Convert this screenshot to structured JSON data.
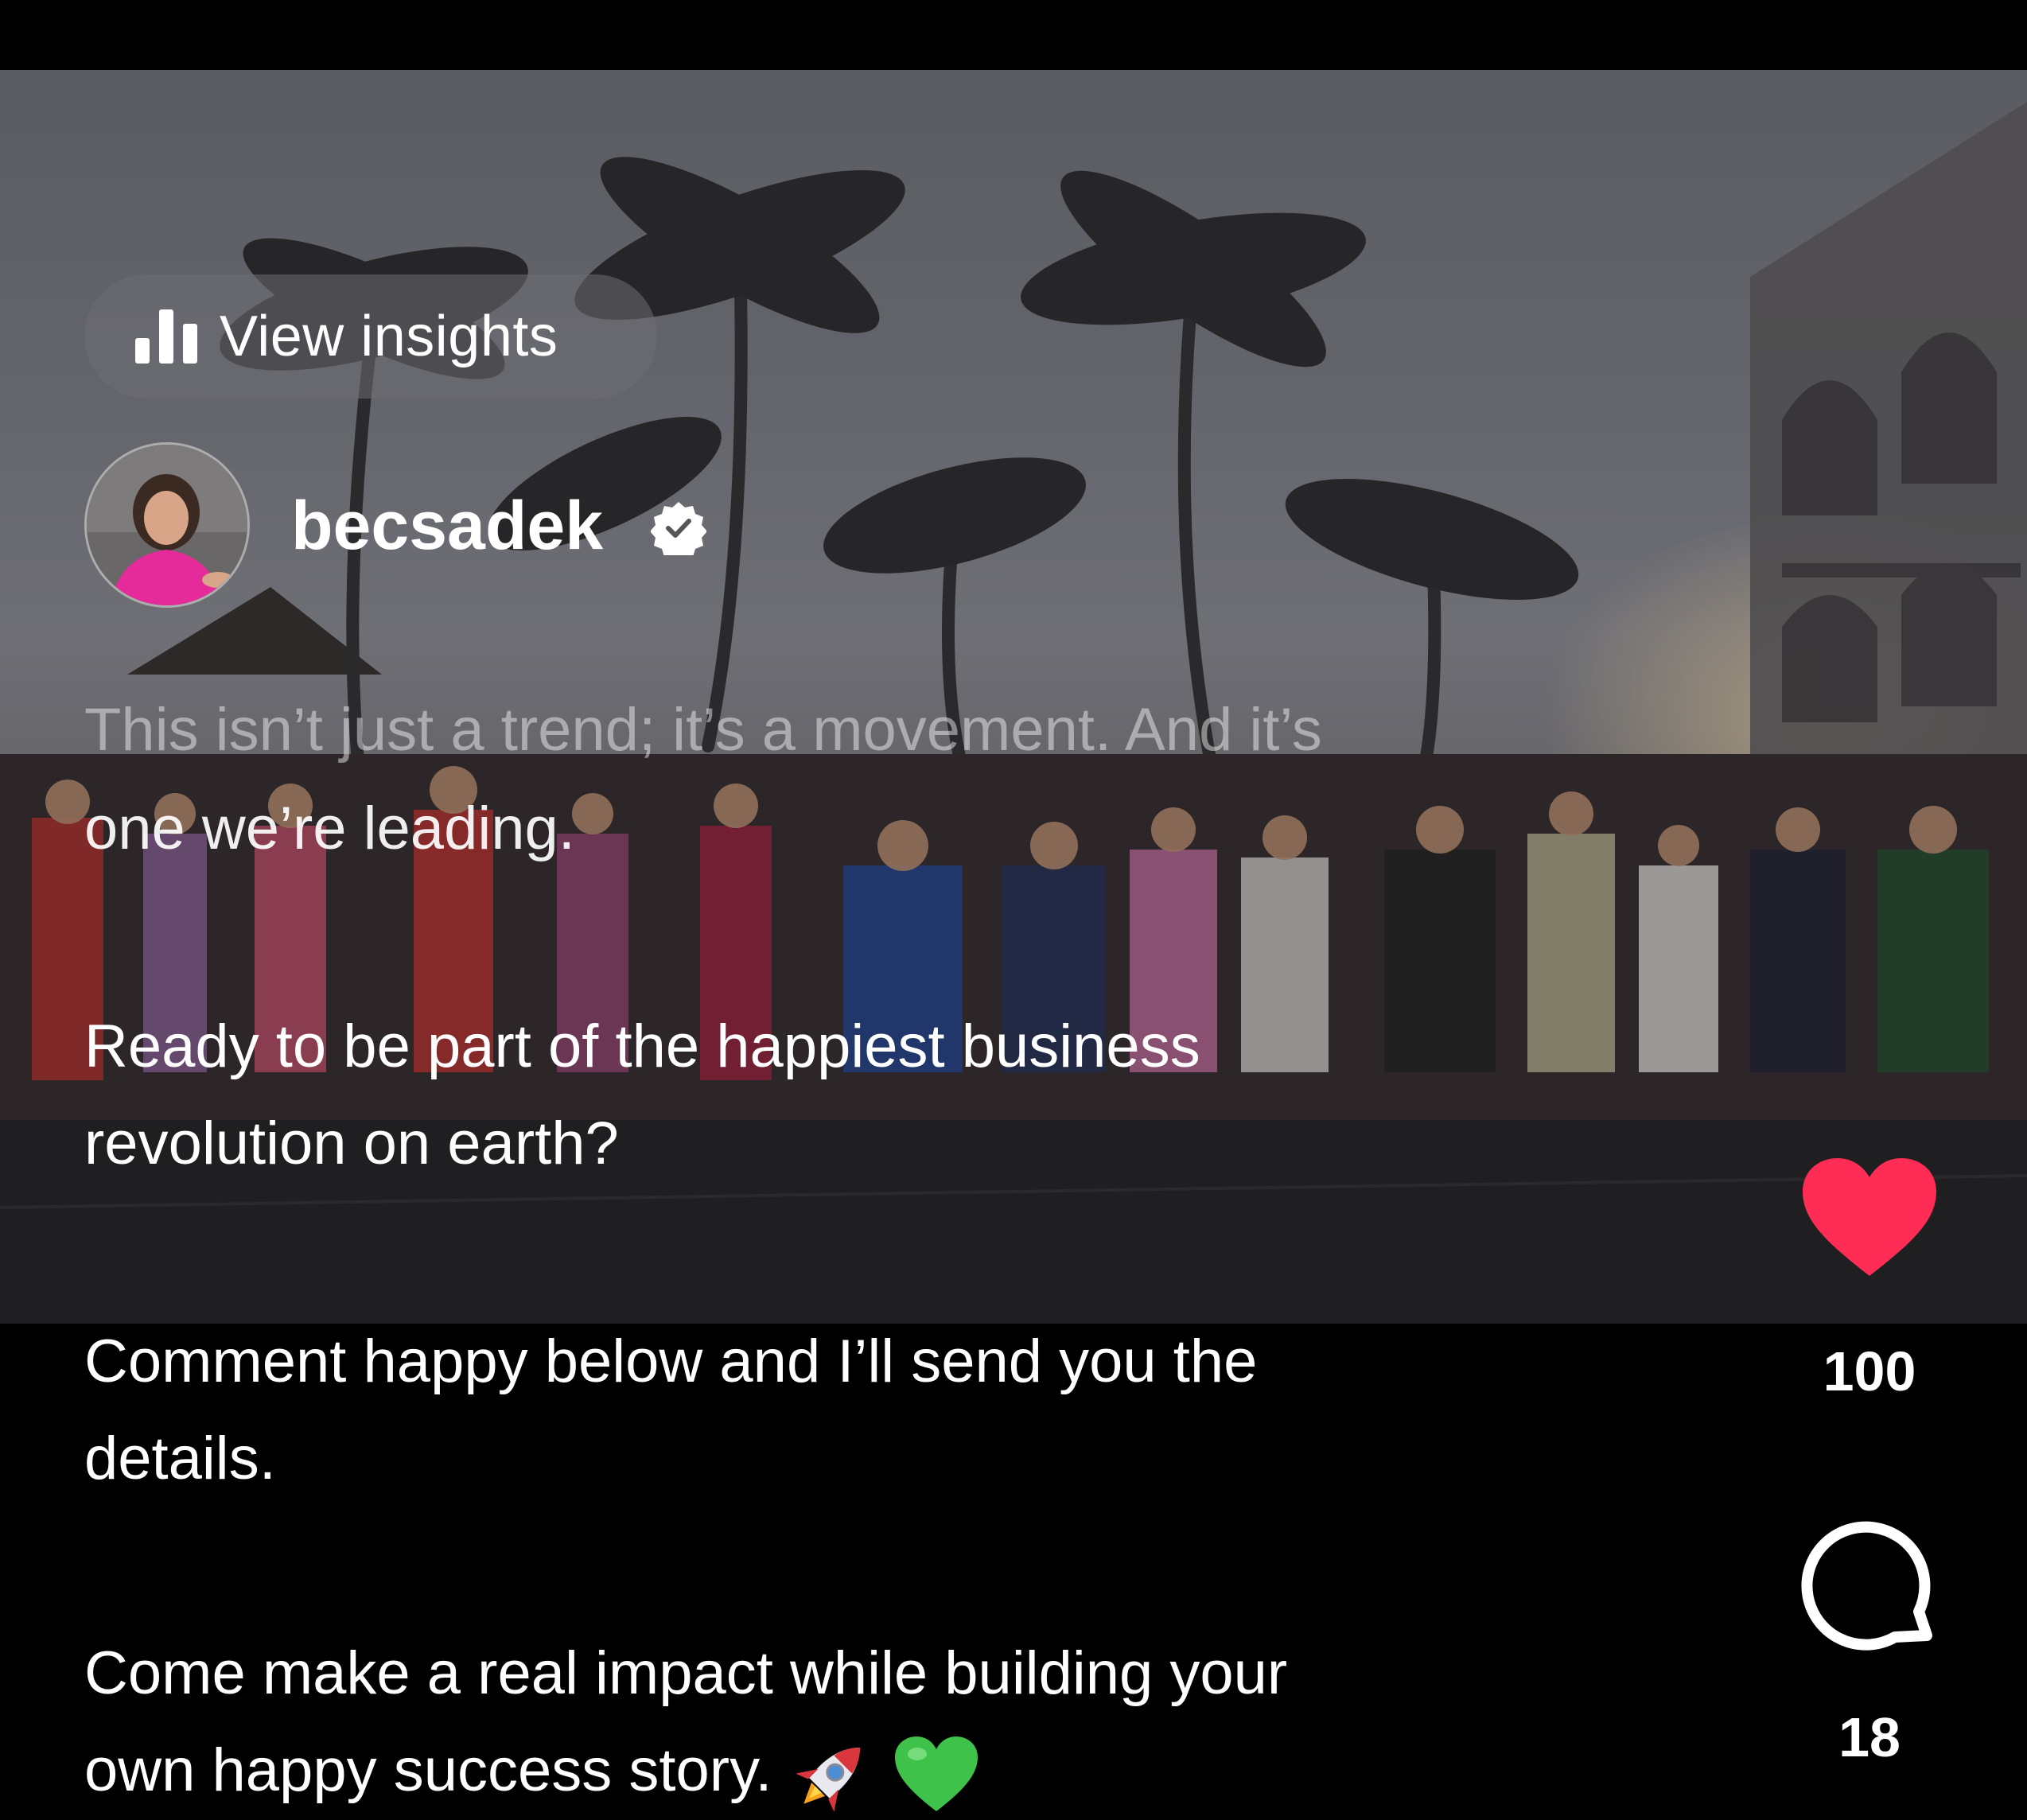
{
  "insights": {
    "label": "View insights",
    "icon": "bar-chart-icon"
  },
  "profile": {
    "username": "becsadek",
    "verified": true,
    "avatar_icon": "profile-photo"
  },
  "caption": {
    "line1": "This isn’t just a trend; it’s a movement. And it’s",
    "line2": "one we’re leading.",
    "line3": "Ready to be part of the happiest business",
    "line4": "revolution on earth?",
    "line5": "Comment happy below and I’ll send you the",
    "line6": "details.",
    "line7": "Come make a real impact while building your",
    "line8": "own happy success story.",
    "emoji_1": "rocket-emoji",
    "emoji_2": "green-heart-emoji"
  },
  "actions": {
    "like_count": "100",
    "liked": true,
    "like_color": "#ff2d55",
    "comment_count": "18"
  }
}
